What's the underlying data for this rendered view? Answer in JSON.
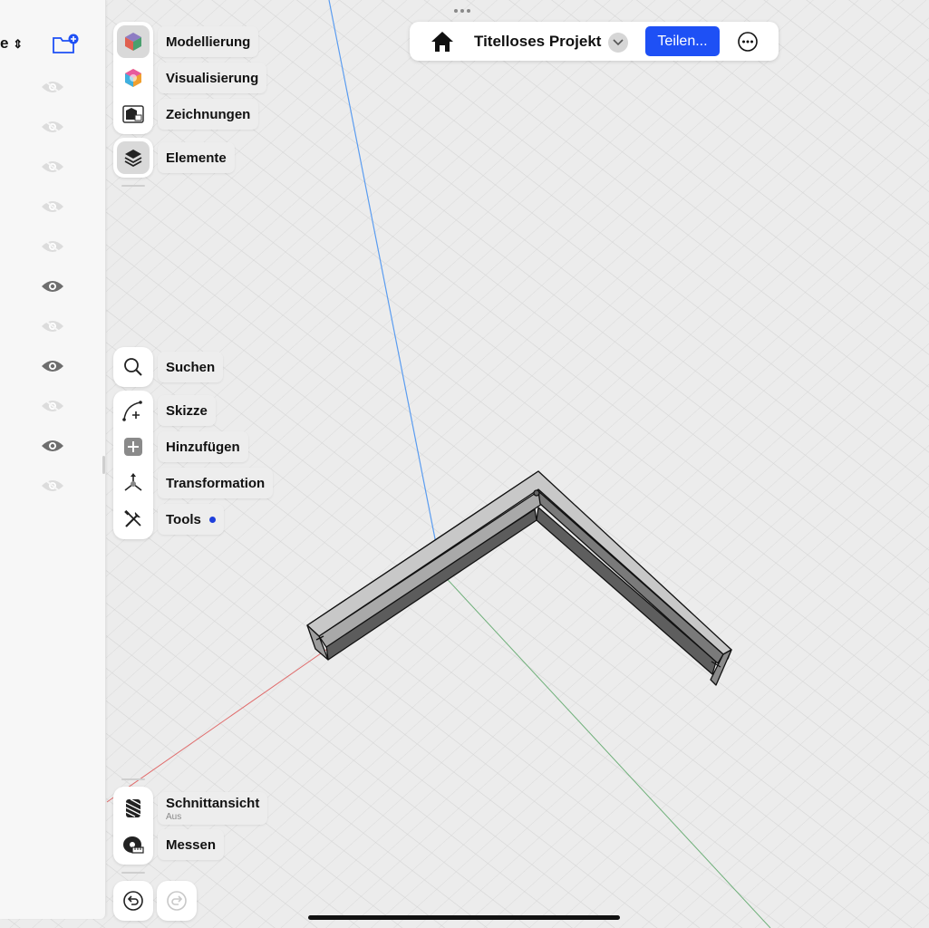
{
  "colors": {
    "accent": "#1e50f5",
    "tools_dot": "#1e3fdc",
    "axis_x": "#e06a6a",
    "axis_y": "#6fb07a",
    "axis_z": "#5a9cf0"
  },
  "sidebar": {
    "title_fragment": "e",
    "visibility": [
      "hidden",
      "hidden",
      "hidden",
      "hidden",
      "hidden",
      "visible",
      "hidden",
      "visible",
      "hidden",
      "visible",
      "hidden"
    ]
  },
  "workspaces": [
    {
      "label": "Modellierung",
      "icon": "modeling-cube-icon",
      "active": true
    },
    {
      "label": "Visualisierung",
      "icon": "visualization-icon",
      "active": false
    },
    {
      "label": "Zeichnungen",
      "icon": "drawings-icon",
      "active": false
    }
  ],
  "elements": {
    "label": "Elemente",
    "icon": "layers-icon",
    "active": true
  },
  "tools": {
    "search": {
      "label": "Suchen",
      "icon": "search-icon"
    },
    "items": [
      {
        "label": "Skizze",
        "icon": "sketch-icon"
      },
      {
        "label": "Hinzufügen",
        "icon": "add-icon"
      },
      {
        "label": "Transformation",
        "icon": "transform-icon"
      },
      {
        "label": "Tools",
        "icon": "tools-icon"
      }
    ]
  },
  "bottom_tools": {
    "section": {
      "label": "Schnittansicht",
      "status": "Aus",
      "icon": "section-view-icon"
    },
    "measure": {
      "label": "Messen",
      "icon": "tape-measure-icon"
    }
  },
  "topbar": {
    "project_title": "Titelloses Projekt",
    "share_label": "Teilen...",
    "home_icon": "home-icon",
    "more_icon": "more-icon"
  }
}
